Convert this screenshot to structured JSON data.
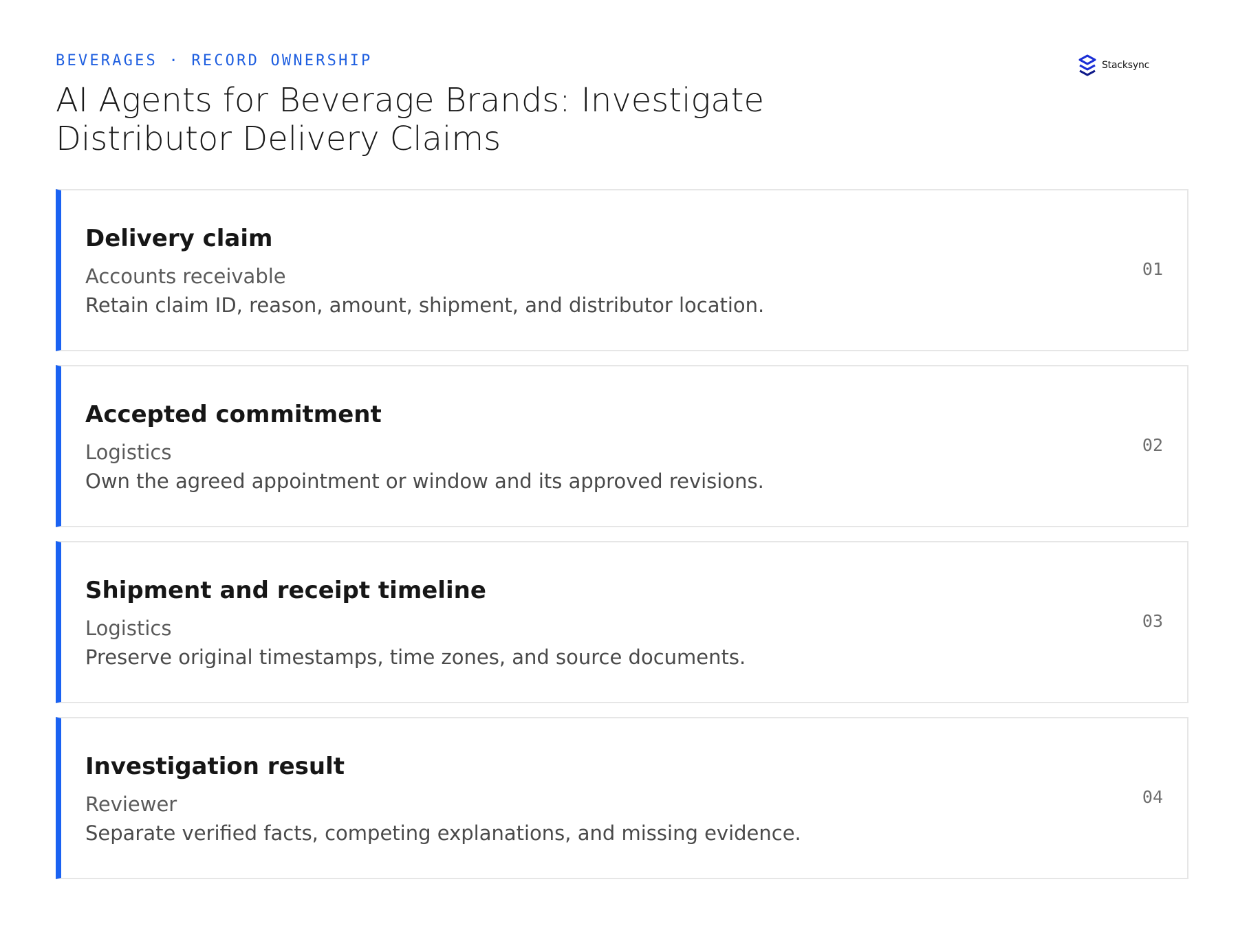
{
  "header": {
    "eyebrow": "BEVERAGES · RECORD OWNERSHIP",
    "title": "AI Agents for Beverage Brands: Investigate Distributor Delivery Claims",
    "logo_text": "Stacksync"
  },
  "colors": {
    "accent": "#1a62f2",
    "eyebrow": "#1f5fe0",
    "card_border": "#e6e6e6"
  },
  "records": [
    {
      "title": "Delivery claim",
      "owner": "Accounts receivable",
      "description": "Retain claim ID, reason, amount, shipment, and distributor location.",
      "number": "01"
    },
    {
      "title": "Accepted commitment",
      "owner": "Logistics",
      "description": "Own the agreed appointment or window and its approved revisions.",
      "number": "02"
    },
    {
      "title": "Shipment and receipt timeline",
      "owner": "Logistics",
      "description": "Preserve original timestamps, time zones, and source documents.",
      "number": "03"
    },
    {
      "title": "Investigation result",
      "owner": "Reviewer",
      "description": "Separate verified facts, competing explanations, and missing evidence.",
      "number": "04"
    }
  ]
}
